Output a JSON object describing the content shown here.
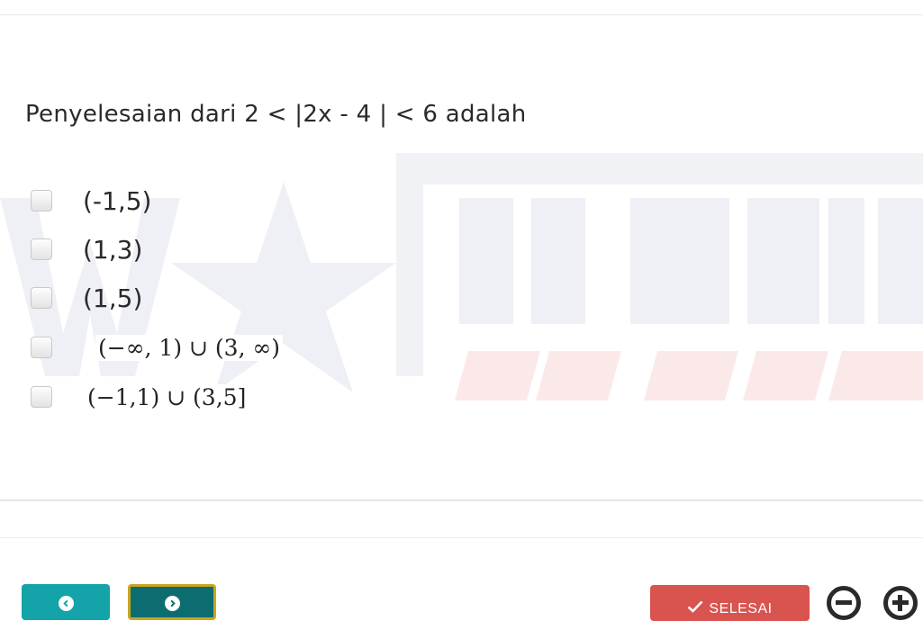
{
  "question": {
    "text": "Penyelesaian dari 2 < |2x - 4 | < 6 adalah"
  },
  "options": [
    {
      "label": "(-1,5)",
      "checked": false
    },
    {
      "label": "(1,3)",
      "checked": false
    },
    {
      "label": "(1,5)",
      "checked": false
    },
    {
      "label": "(−∞, 1) ∪ (3, ∞)",
      "checked": false
    },
    {
      "label": "(−1,1) ∪ (3,5]",
      "checked": false
    }
  ],
  "watermark": {
    "text_top": "W★NGSIT",
    "text_bottom": "OM JERO"
  },
  "nav": {
    "prev_icon": "chevron-left-icon",
    "next_icon": "chevron-right-icon",
    "done_label": "SELESAI",
    "done_icon": "check-icon",
    "zoom_out_icon": "minus-circle-icon",
    "zoom_in_icon": "plus-circle-icon"
  },
  "colors": {
    "prev_button": "#14a3a8",
    "next_button": "#0d6c70",
    "next_border": "#c9a620",
    "done_button": "#d9534f",
    "watermark": "#eef0f5",
    "watermark_red": "#fbe9e9"
  }
}
